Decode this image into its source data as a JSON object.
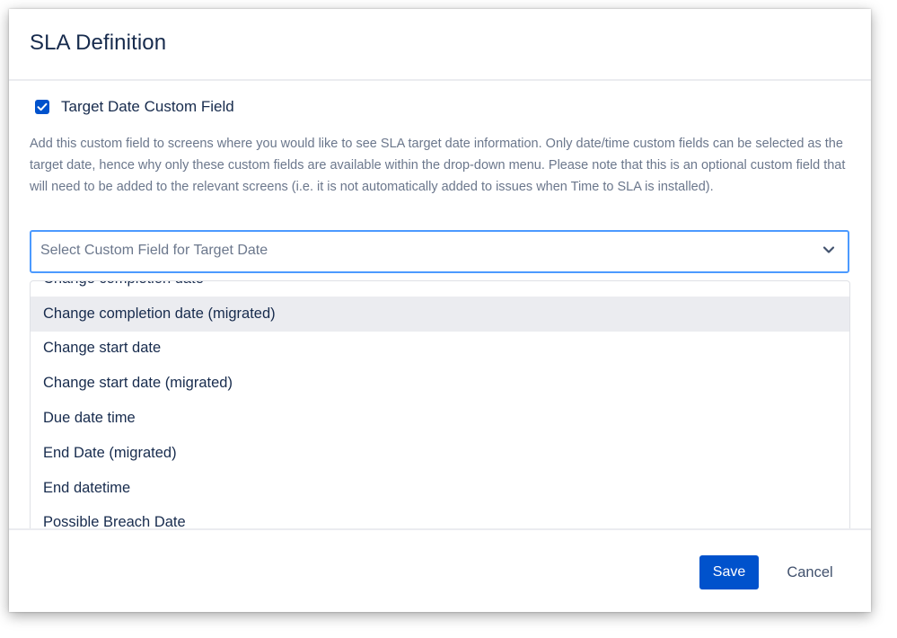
{
  "dialog": {
    "title": "SLA Definition"
  },
  "target_date": {
    "checkbox_checked": true,
    "checkbox_icon": "check-icon",
    "label": "Target Date Custom Field",
    "help_text": "Add this custom field to screens where you would like to see SLA target date information. Only date/time custom fields can be selected as the target date, hence why only these custom fields are available within the drop-down menu. Please note that this is an optional custom field that will need to be added to the relevant screens (i.e. it is not automatically added to issues when Time to SLA is installed).",
    "select_placeholder": "Select Custom Field for Target Date",
    "select_icon": "chevron-down-icon",
    "options": [
      {
        "label": "Change completion date",
        "highlighted": false
      },
      {
        "label": "Change completion date (migrated)",
        "highlighted": true
      },
      {
        "label": "Change start date",
        "highlighted": false
      },
      {
        "label": "Change start date (migrated)",
        "highlighted": false
      },
      {
        "label": "Due date time",
        "highlighted": false
      },
      {
        "label": "End Date (migrated)",
        "highlighted": false
      },
      {
        "label": "End datetime",
        "highlighted": false
      },
      {
        "label": "Possible Breach Date",
        "highlighted": false
      }
    ]
  },
  "footer": {
    "save_label": "Save",
    "cancel_label": "Cancel"
  },
  "colors": {
    "primary": "#0052cc",
    "focus_border": "#4c9aff",
    "highlight_bg": "#ebecf0",
    "text": "#172b4d",
    "muted_text": "#6b778c"
  }
}
